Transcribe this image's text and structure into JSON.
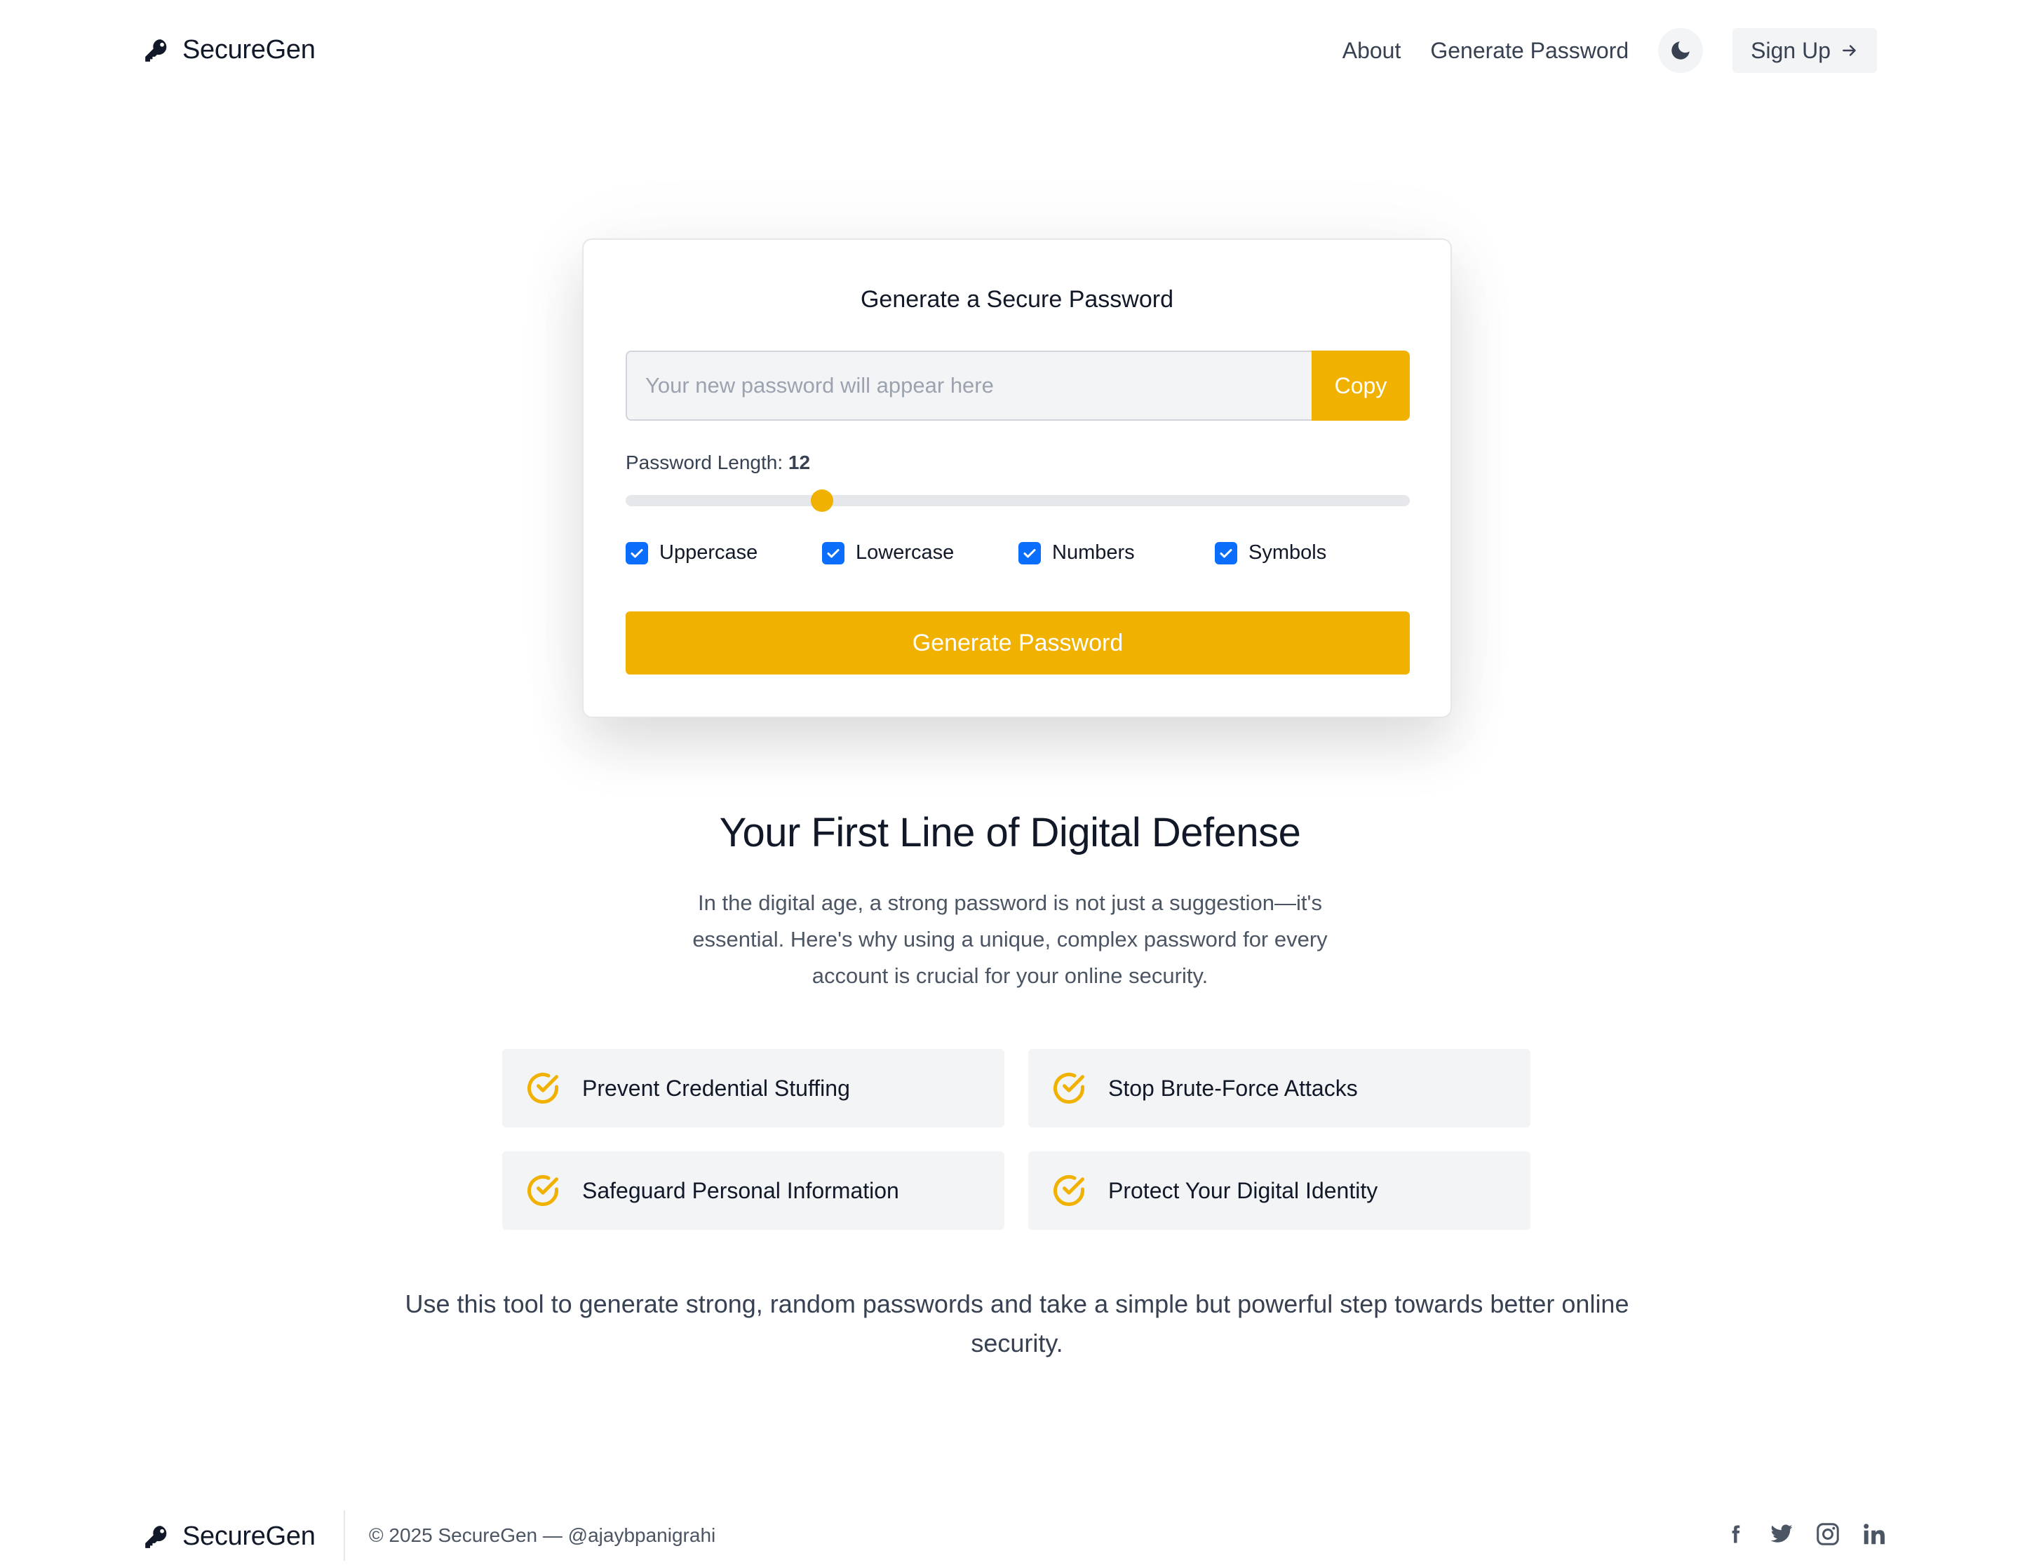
{
  "brand": {
    "name": "SecureGen"
  },
  "nav": {
    "about": "About",
    "generate": "Generate Password",
    "signup": "Sign Up"
  },
  "generator": {
    "title": "Generate a Secure Password",
    "password_value": "",
    "password_placeholder": "Your new password will appear here",
    "copy_label": "Copy",
    "length_label": "Password Length:",
    "length_value": "12",
    "slider_fraction": 0.25,
    "options": [
      {
        "label": "Uppercase",
        "checked": true
      },
      {
        "label": "Lowercase",
        "checked": true
      },
      {
        "label": "Numbers",
        "checked": true
      },
      {
        "label": "Symbols",
        "checked": true
      }
    ],
    "generate_label": "Generate Password"
  },
  "section": {
    "headline": "Your First Line of Digital Defense",
    "intro": "In the digital age, a strong password is not just a suggestion—it's essential. Here's why using a unique, complex password for every account is crucial for your online security.",
    "features": [
      "Prevent Credential Stuffing",
      "Stop Brute-Force Attacks",
      "Safeguard Personal Information",
      "Protect Your Digital Identity"
    ],
    "closing": "Use this tool to generate strong, random passwords and take a simple but powerful step towards better online security."
  },
  "footer": {
    "copyright": "© 2025 SecureGen — @ajaybpanigrahi",
    "socials": [
      "facebook-icon",
      "twitter-icon",
      "instagram-icon",
      "linkedin-icon"
    ]
  },
  "colors": {
    "accent": "#f0b100",
    "checkbox": "#0b6dfb",
    "text": "#111827",
    "muted": "#4b5563",
    "panel": "#f3f4f6"
  }
}
